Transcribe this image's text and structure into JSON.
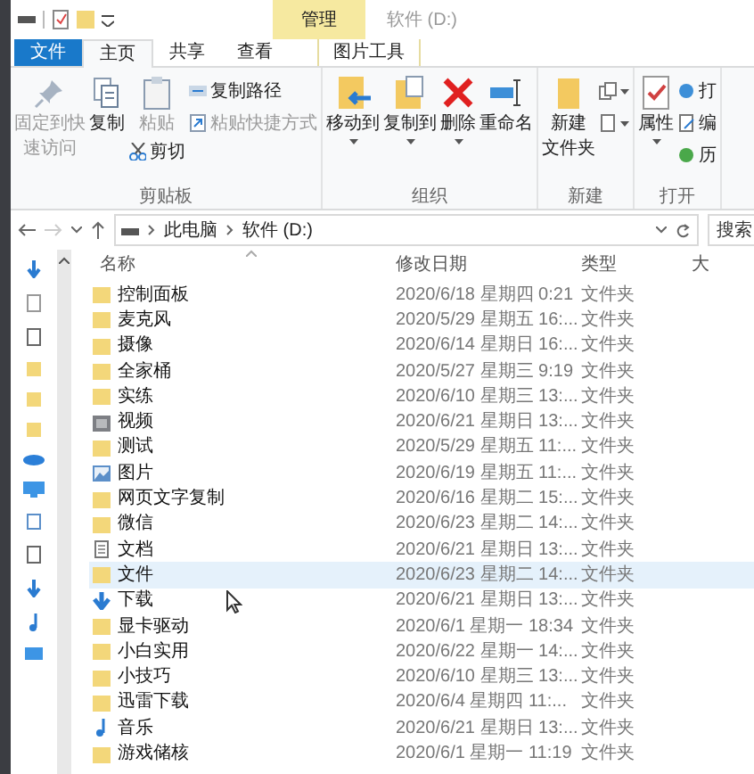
{
  "title_bar": {
    "context_tab": "管理",
    "title": "软件 (D:)"
  },
  "tabs": [
    {
      "label": "文件",
      "kind": "file",
      "selected": false
    },
    {
      "label": "主页",
      "kind": "tab",
      "selected": true
    },
    {
      "label": "共享",
      "kind": "tab",
      "selected": false
    },
    {
      "label": "查看",
      "kind": "tab",
      "selected": false
    },
    {
      "label": "图片工具",
      "kind": "context",
      "selected": false
    }
  ],
  "ribbon": [
    {
      "label": "剪贴板",
      "items": [
        {
          "kind": "large",
          "lines": [
            "固定到快",
            "速访问"
          ],
          "disabled": true
        },
        {
          "kind": "large",
          "lines": [
            "复制"
          ],
          "disabled": false
        },
        {
          "kind": "large",
          "lines": [
            "粘贴"
          ],
          "disabled": true,
          "small": {
            "label": "剪切",
            "disabled": false
          }
        },
        {
          "kind": "stack",
          "items": [
            {
              "label": "复制路径",
              "disabled": false
            },
            {
              "label": "粘贴快捷方式",
              "disabled": true
            }
          ]
        }
      ]
    },
    {
      "label": "组织",
      "items": [
        {
          "kind": "large",
          "lines": [
            "移动到"
          ],
          "dropdown": true
        },
        {
          "kind": "large",
          "lines": [
            "复制到"
          ],
          "dropdown": true
        },
        {
          "kind": "large",
          "lines": [
            "删除"
          ],
          "dropdown": true
        },
        {
          "kind": "large",
          "lines": [
            "重命名"
          ]
        }
      ]
    },
    {
      "label": "新建",
      "items": [
        {
          "kind": "large",
          "lines": [
            "新建",
            "文件夹"
          ]
        },
        {
          "kind": "stack",
          "items": [
            {
              "dropdown": true
            },
            {
              "dropdown": true
            }
          ]
        }
      ]
    },
    {
      "label": "打开",
      "items": [
        {
          "kind": "large",
          "lines": [
            "属性"
          ],
          "dropdown": true
        },
        {
          "kind": "stack",
          "items": [
            {
              "label": "打"
            },
            {
              "label": "编"
            },
            {
              "label": "历"
            }
          ]
        }
      ]
    }
  ],
  "address": {
    "path": [
      "此电脑",
      "软件 (D:)"
    ],
    "search_placeholder": "搜索"
  },
  "columns": [
    "名称",
    "修改日期",
    "类型",
    "大"
  ],
  "files": [
    {
      "name": "控制面板",
      "date": "2020/6/18 星期四 0:21",
      "type": "文件夹",
      "kind": "folder",
      "selected": false
    },
    {
      "name": "麦克风",
      "date": "2020/5/29 星期五 16:...",
      "type": "文件夹",
      "kind": "folder",
      "selected": false
    },
    {
      "name": "摄像",
      "date": "2020/6/14 星期日 16:...",
      "type": "文件夹",
      "kind": "folder",
      "selected": false
    },
    {
      "name": "全家桶",
      "date": "2020/5/27 星期三 9:19",
      "type": "文件夹",
      "kind": "folder",
      "selected": false
    },
    {
      "name": "实练",
      "date": "2020/6/10 星期三 13:...",
      "type": "文件夹",
      "kind": "folder",
      "selected": false
    },
    {
      "name": "视频",
      "date": "2020/6/21 星期日 13:...",
      "type": "文件夹",
      "kind": "video",
      "selected": false
    },
    {
      "name": "测试",
      "date": "2020/5/29 星期五 11:...",
      "type": "文件夹",
      "kind": "folder",
      "selected": false
    },
    {
      "name": "图片",
      "date": "2020/6/19 星期五 11:...",
      "type": "文件夹",
      "kind": "picture",
      "selected": false
    },
    {
      "name": "网页文字复制",
      "date": "2020/6/16 星期二 15:...",
      "type": "文件夹",
      "kind": "folder",
      "selected": false
    },
    {
      "name": "微信",
      "date": "2020/6/23 星期二 14:...",
      "type": "文件夹",
      "kind": "folder",
      "selected": false
    },
    {
      "name": "文档",
      "date": "2020/6/21 星期日 13:...",
      "type": "文件夹",
      "kind": "document",
      "selected": false
    },
    {
      "name": "文件",
      "date": "2020/6/23 星期二 14:...",
      "type": "文件夹",
      "kind": "folder",
      "selected": true
    },
    {
      "name": "下载",
      "date": "2020/6/21 星期日 13:...",
      "type": "文件夹",
      "kind": "download",
      "selected": false
    },
    {
      "name": "显卡驱动",
      "date": "2020/6/1 星期一 18:34",
      "type": "文件夹",
      "kind": "folder",
      "selected": false
    },
    {
      "name": "小白实用",
      "date": "2020/6/22 星期一 14:...",
      "type": "文件夹",
      "kind": "folder",
      "selected": false
    },
    {
      "name": "小技巧",
      "date": "2020/6/10 星期三 13:...",
      "type": "文件夹",
      "kind": "folder",
      "selected": false
    },
    {
      "name": "迅雷下载",
      "date": "2020/6/4 星期四 11:...",
      "type": "文件夹",
      "kind": "folder",
      "selected": false
    },
    {
      "name": "音乐",
      "date": "2020/6/21 星期日 13:...",
      "type": "文件夹",
      "kind": "music",
      "selected": false
    },
    {
      "name": "游戏储核",
      "date": "2020/6/1 星期一 11:19",
      "type": "文件夹",
      "kind": "folder",
      "selected": false
    }
  ]
}
